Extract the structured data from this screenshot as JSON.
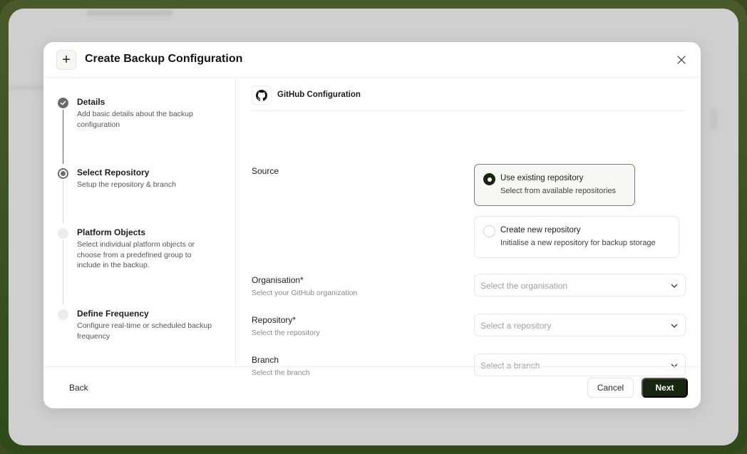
{
  "modal": {
    "title": "Create Backup Configuration",
    "header_icon": "plus-icon",
    "close_icon": "close-icon"
  },
  "steps": [
    {
      "title": "Details",
      "desc": "Add basic details about the backup configuration",
      "state": "done"
    },
    {
      "title": "Select Repository",
      "desc": "Setup the repository & branch",
      "state": "active"
    },
    {
      "title": "Platform Objects",
      "desc": "Select individual platform objects or choose from a predefined group to include in the backup.",
      "state": "pending"
    },
    {
      "title": "Define Frequency",
      "desc": "Configure real-time or scheduled backup frequency",
      "state": "pending"
    }
  ],
  "section": {
    "title": "GitHub Configuration",
    "icon": "github-icon"
  },
  "source": {
    "label": "Source",
    "options": [
      {
        "title": "Use existing repository",
        "desc": "Select from available repositories",
        "selected": true
      },
      {
        "title": "Create new repository",
        "desc": "Initialise a new repository for backup storage",
        "selected": false
      }
    ]
  },
  "fields": {
    "organisation": {
      "label": "Organisation*",
      "hint": "Select your GitHub organization",
      "placeholder": "Select the organisation"
    },
    "repository": {
      "label": "Repository*",
      "hint": "Select the repository",
      "placeholder": "Select a repository"
    },
    "branch": {
      "label": "Branch",
      "hint": "Select the branch",
      "placeholder": "Select a branch"
    }
  },
  "footer": {
    "back_label": "Back",
    "cancel_label": "Cancel",
    "next_label": "Next"
  },
  "colors": {
    "primary": "#17260f",
    "frame": "#3b4a1f"
  }
}
